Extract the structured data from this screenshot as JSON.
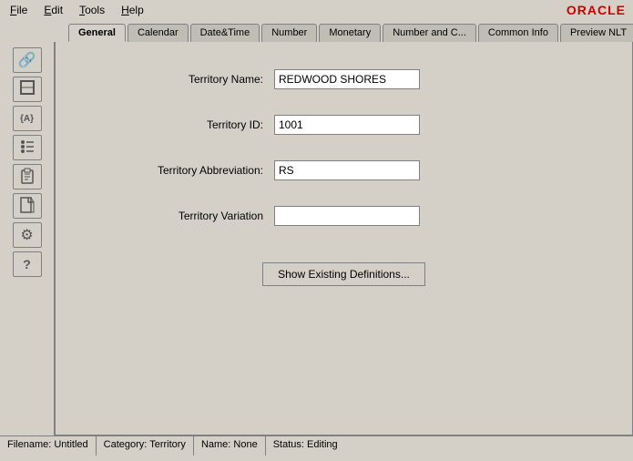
{
  "menubar": {
    "items": [
      {
        "label": "File",
        "underline": "F"
      },
      {
        "label": "Edit",
        "underline": "E"
      },
      {
        "label": "Tools",
        "underline": "T"
      },
      {
        "label": "Help",
        "underline": "H"
      }
    ],
    "logo": "ORACLE"
  },
  "tabs": [
    {
      "label": "General",
      "active": true
    },
    {
      "label": "Calendar",
      "active": false
    },
    {
      "label": "Date&Time",
      "active": false
    },
    {
      "label": "Number",
      "active": false
    },
    {
      "label": "Monetary",
      "active": false
    },
    {
      "label": "Number and C...",
      "active": false
    },
    {
      "label": "Common Info",
      "active": false
    },
    {
      "label": "Preview NLT",
      "active": false
    }
  ],
  "sidebar": {
    "buttons": [
      {
        "icon": "🔗",
        "name": "link-icon"
      },
      {
        "icon": "◼",
        "name": "shape-icon"
      },
      {
        "icon": "{A}",
        "name": "variable-icon"
      },
      {
        "icon": "⋮⋮",
        "name": "list-icon"
      },
      {
        "icon": "📋",
        "name": "clipboard-icon"
      },
      {
        "icon": "📄",
        "name": "document-icon"
      },
      {
        "icon": "⚙",
        "name": "settings-icon"
      },
      {
        "icon": "?",
        "name": "help-icon"
      }
    ]
  },
  "form": {
    "fields": [
      {
        "label": "Territory Name:",
        "value": "REDWOOD SHORES",
        "name": "territory-name"
      },
      {
        "label": "Territory ID:",
        "value": "1001",
        "name": "territory-id"
      },
      {
        "label": "Territory Abbreviation:",
        "value": "RS",
        "name": "territory-abbreviation"
      },
      {
        "label": "Territory Variation",
        "value": "",
        "name": "territory-variation"
      }
    ],
    "show_button_label": "Show Existing Definitions..."
  },
  "statusbar": {
    "items": [
      {
        "label": "Filename: Untitled",
        "name": "filename-status"
      },
      {
        "label": "Category: Territory",
        "name": "category-status"
      },
      {
        "label": "Name: None",
        "name": "name-status"
      },
      {
        "label": "Status: Editing",
        "name": "editing-status"
      }
    ]
  }
}
